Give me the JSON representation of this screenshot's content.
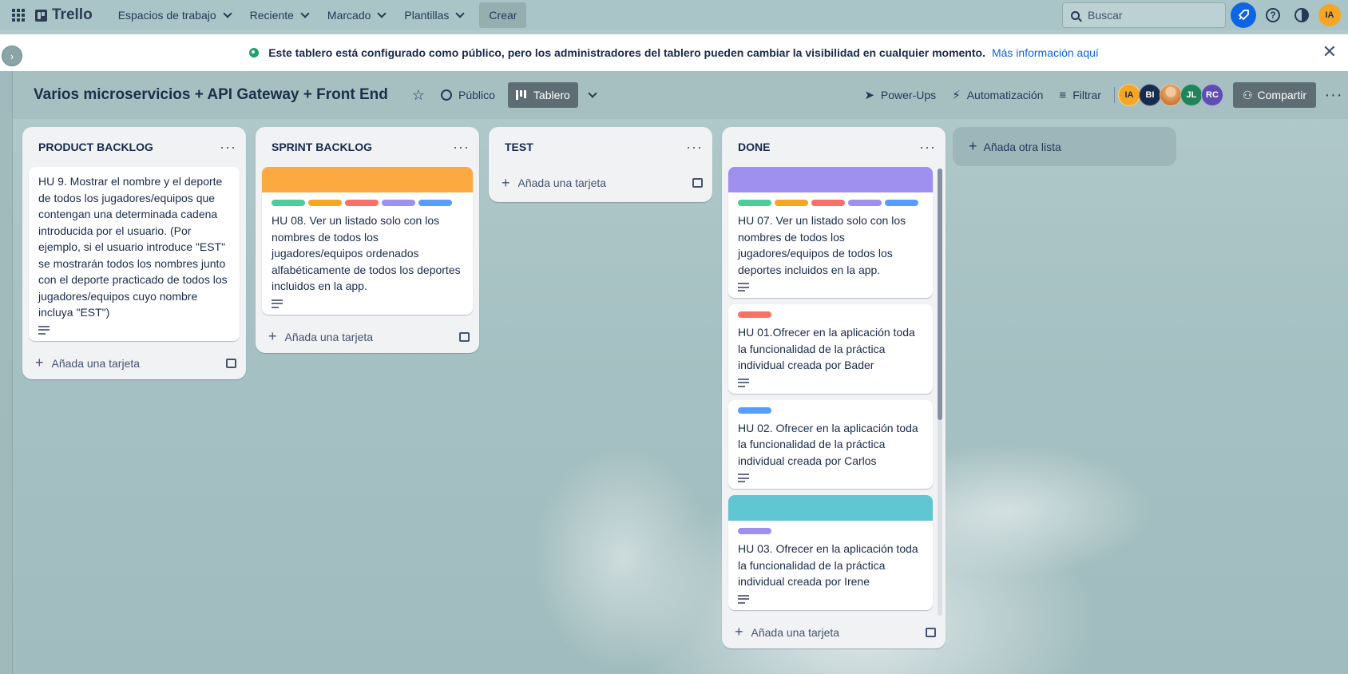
{
  "topbar": {
    "brand": "Trello",
    "nav": [
      "Espacios de trabajo",
      "Reciente",
      "Marcado",
      "Plantillas"
    ],
    "create": "Crear",
    "search_placeholder": "Buscar",
    "user_initials": "IA"
  },
  "banner": {
    "text": "Este tablero está configurado como público, pero los administradores del tablero pueden cambiar la visibilidad en cualquier momento.",
    "link": "Más información aquí",
    "close": "✕"
  },
  "board": {
    "title": "Varios microservicios + API Gateway + Front End",
    "visibility": "Público",
    "view": "Tablero",
    "powerups": "Power-Ups",
    "automation": "Automatización",
    "filter": "Filtrar",
    "share": "Compartir",
    "members": [
      {
        "initials": "IA",
        "color": "#f5a623"
      },
      {
        "initials": "BI",
        "color": "#172b4d"
      },
      {
        "initials": "",
        "color": "#e6a15c"
      },
      {
        "initials": "JL",
        "color": "#1f845a"
      },
      {
        "initials": "RC",
        "color": "#5e4db2"
      }
    ]
  },
  "lists": {
    "product_backlog": {
      "title": "PRODUCT BACKLOG",
      "cards": [
        {
          "text": "HU 9. Mostrar el nombre y el deporte de todos los jugadores/equipos que contengan una determinada cadena introducida por el usuario. (Por ejemplo, si el usuario introduce \"EST\" se mostrarán todos los nombres junto con el deporte practicado de todos los jugadores/equipos cuyo nombre incluya \"EST\")"
        }
      ],
      "add_card": "Añada una tarjeta"
    },
    "sprint_backlog": {
      "title": "SPRINT BACKLOG",
      "cards": [
        {
          "cover": "#fca942",
          "text": "HU 08. Ver un listado solo con los nombres de todos los jugadores/equipos ordenados alfabéticamente de todos los deportes incluidos en la app."
        }
      ],
      "add_card": "Añada una tarjeta"
    },
    "test": {
      "title": "TEST",
      "add_card": "Añada una tarjeta"
    },
    "done": {
      "title": "DONE",
      "cards": [
        {
          "cover": "#9f8fef",
          "text": "HU 07. Ver un listado solo con los nombres de todos los jugadores/equipos de todos los deportes incluidos en la app."
        },
        {
          "text": "HU 01.Ofrecer en la aplicación toda la funcionalidad de la práctica individual creada por Bader"
        },
        {
          "text": "HU 02. Ofrecer en la aplicación toda la funcionalidad de la práctica individual creada por Carlos"
        },
        {
          "cover": "#60c6d2",
          "text": "HU 03. Ofrecer en la aplicación toda la funcionalidad de la práctica individual creada por Irene"
        }
      ],
      "add_card": "Añada una tarjeta"
    }
  },
  "add_list": "Añada otra lista",
  "label_colors": {
    "green": "#4bce97",
    "yellow": "#f5a623",
    "red": "#f87168",
    "purple": "#9f8fef",
    "blue": "#579dff"
  },
  "icons": [
    "apps-grid-icon",
    "trello-logo-icon",
    "search-icon",
    "rocket-icon",
    "help-icon",
    "contrast-icon",
    "globe-icon",
    "close-icon",
    "star-icon",
    "public-icon",
    "board-icon",
    "chevron-down-icon",
    "powerups-icon",
    "automation-icon",
    "filter-icon",
    "share-icon",
    "more-icon",
    "plus-icon",
    "template-icon",
    "description-icon"
  ]
}
